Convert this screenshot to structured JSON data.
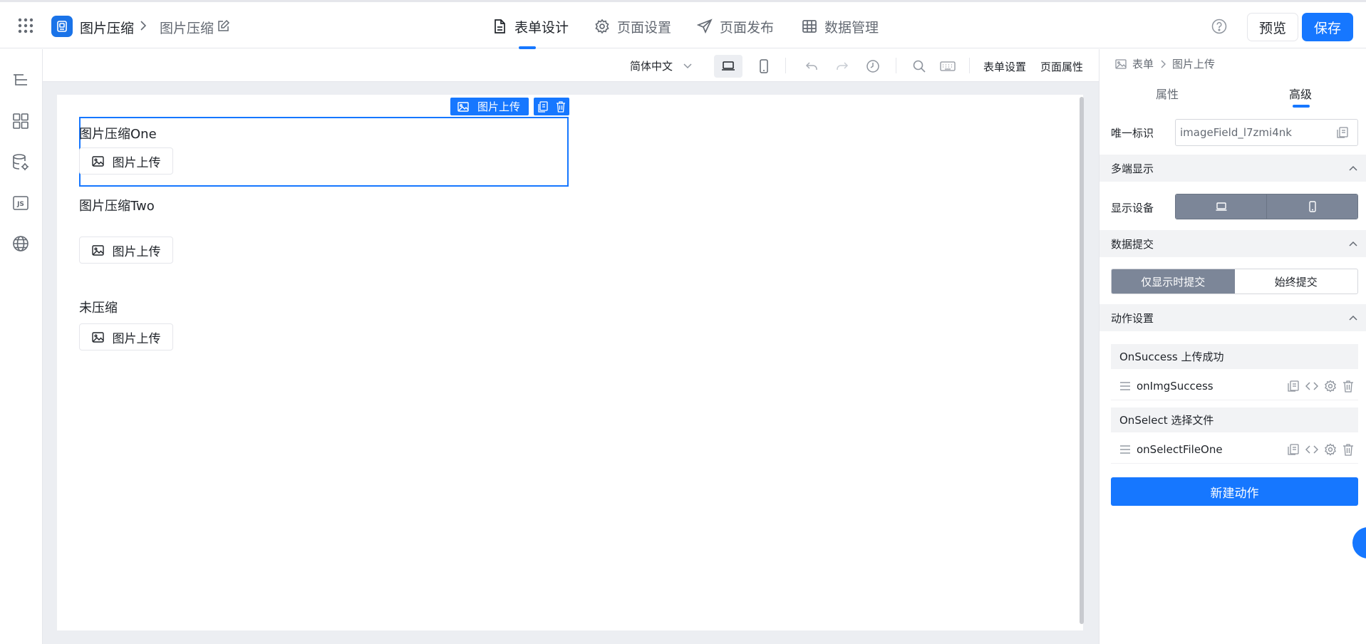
{
  "header": {
    "app_name": "图片压缩",
    "page_name": "图片压缩",
    "nav": [
      {
        "label": "表单设计",
        "icon": "file-icon",
        "active": true
      },
      {
        "label": "页面设置",
        "icon": "gear-icon",
        "active": false
      },
      {
        "label": "页面发布",
        "icon": "send-icon",
        "active": false
      },
      {
        "label": "数据管理",
        "icon": "table-icon",
        "active": false
      }
    ],
    "preview_label": "预览",
    "save_label": "保存",
    "accent": "#1677ff"
  },
  "left_rail": [
    "outline-icon",
    "components-icon",
    "datasource-icon",
    "js-icon",
    "globe-icon"
  ],
  "left_rail_js_text": "JS",
  "toolbar": {
    "language": "简体中文",
    "form_settings": "表单设置",
    "page_properties": "页面属性"
  },
  "canvas": {
    "selected_tag": "图片上传",
    "fields": [
      {
        "label": "图片压缩One",
        "button": "图片上传"
      },
      {
        "label": "图片压缩Two",
        "button": "图片上传"
      },
      {
        "label": "未压缩",
        "button": "图片上传"
      }
    ]
  },
  "panel": {
    "breadcrumb": [
      "表单",
      "图片上传"
    ],
    "tabs": [
      {
        "label": "属性",
        "active": false
      },
      {
        "label": "高级",
        "active": true
      }
    ],
    "unique_id_label": "唯一标识",
    "unique_id_value": "imageField_l7zmi4nk",
    "multi_display": {
      "title": "多端显示",
      "device_label": "显示设备"
    },
    "data_submit": {
      "title": "数据提交",
      "options": [
        "仅显示时提交",
        "始终提交"
      ],
      "selected": "仅显示时提交"
    },
    "actions": {
      "title": "动作设置",
      "events": [
        {
          "event": "OnSuccess 上传成功",
          "handler": "onImgSuccess"
        },
        {
          "event": "OnSelect 选择文件",
          "handler": "onSelectFileOne"
        }
      ],
      "new_action_label": "新建动作"
    }
  }
}
